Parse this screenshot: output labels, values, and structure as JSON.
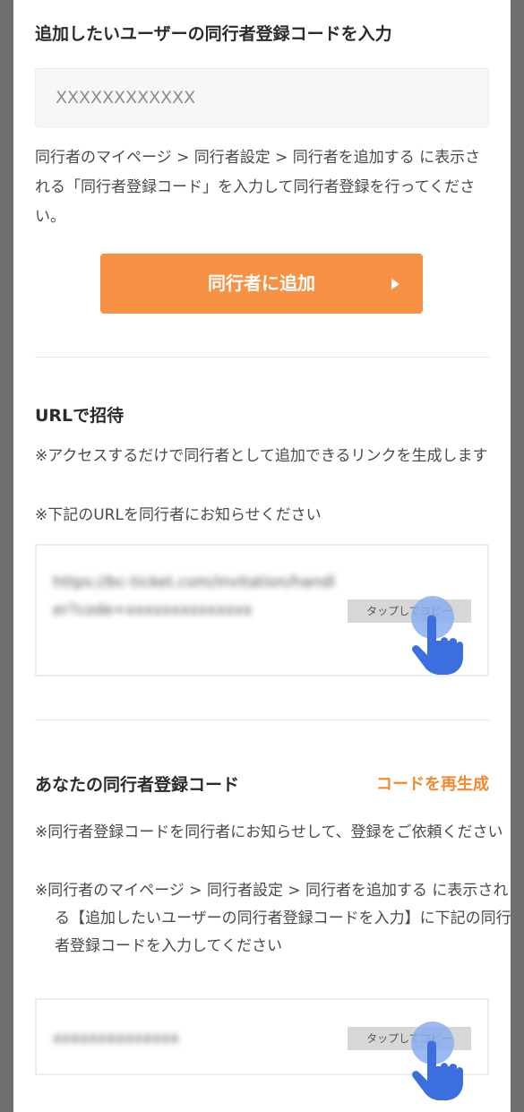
{
  "add_companion": {
    "heading": "追加したいユーザーの同行者登録コードを入力",
    "input_placeholder": "XXXXXXXXXXXX",
    "instructions": "同行者のマイページ > 同行者設定 > 同行者を追加する に表示される「同行者登録コード」を入力して同行者登録を行ってください。",
    "button_label": "同行者に追加"
  },
  "invite_url": {
    "heading": "URLで招待",
    "notes": [
      "※アクセスするだけで同行者として追加できるリンクを生成します",
      "※下記のURLを同行者にお知らせください"
    ],
    "url_value": "https://bc-ticket.com/invitation/handler?code=xxxxxxxxxxxxxx",
    "copy_label": "タップしてコピー"
  },
  "my_code": {
    "heading": "あなたの同行者登録コード",
    "regenerate_label": "コードを再生成",
    "notes": [
      "※同行者登録コードを同行者にお知らせして、登録をご依頼ください",
      "※同行者のマイページ > 同行者設定 > 同行者を追加する に表示される【追加したいユーザーの同行者登録コードを入力】に下記の同行者登録コードを入力してください"
    ],
    "code_value": "xxxxxxxxxxxxxx",
    "copy_label": "タップしてコピー"
  },
  "colors": {
    "accent": "#f79244",
    "link": "#f5892f",
    "tap_circle": "#8aaef0",
    "hand": "#3b6fe0"
  }
}
